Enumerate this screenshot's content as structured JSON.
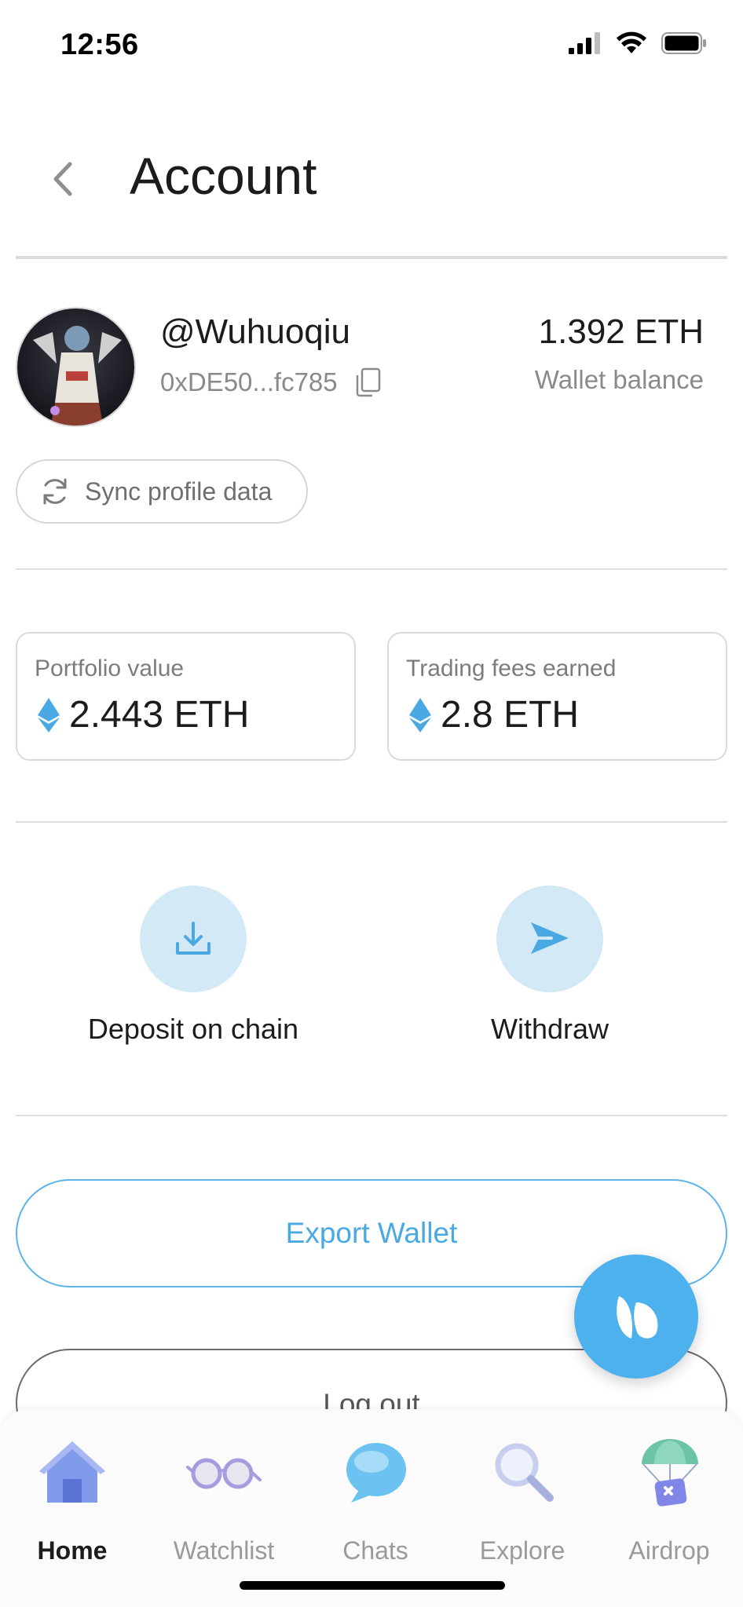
{
  "status_bar": {
    "time": "12:56"
  },
  "header": {
    "title": "Account"
  },
  "profile": {
    "username": "@Wuhuoqiu",
    "address": "0xDE50...fc785",
    "balance_value": "1.392 ETH",
    "balance_label": "Wallet balance",
    "sync_label": "Sync profile data"
  },
  "stats": [
    {
      "label": "Portfolio value",
      "value": "2.443 ETH"
    },
    {
      "label": "Trading fees earned",
      "value": "2.8 ETH"
    }
  ],
  "actions": [
    {
      "label": "Deposit on chain",
      "icon": "download-icon"
    },
    {
      "label": "Withdraw",
      "icon": "send-icon"
    }
  ],
  "buttons": {
    "export": "Export Wallet",
    "logout": "Log out"
  },
  "nav": {
    "items": [
      {
        "label": "Home",
        "icon": "home-icon",
        "active": true
      },
      {
        "label": "Watchlist",
        "icon": "glasses-icon",
        "active": false
      },
      {
        "label": "Chats",
        "icon": "chat-bubble-icon",
        "active": false
      },
      {
        "label": "Explore",
        "icon": "magnifier-icon",
        "active": false
      },
      {
        "label": "Airdrop",
        "icon": "parachute-gift-icon",
        "active": false
      }
    ]
  },
  "colors": {
    "accent": "#4cb1ec",
    "action_bg": "#d3e9f6",
    "eth_blue": "#4aa8e2"
  }
}
